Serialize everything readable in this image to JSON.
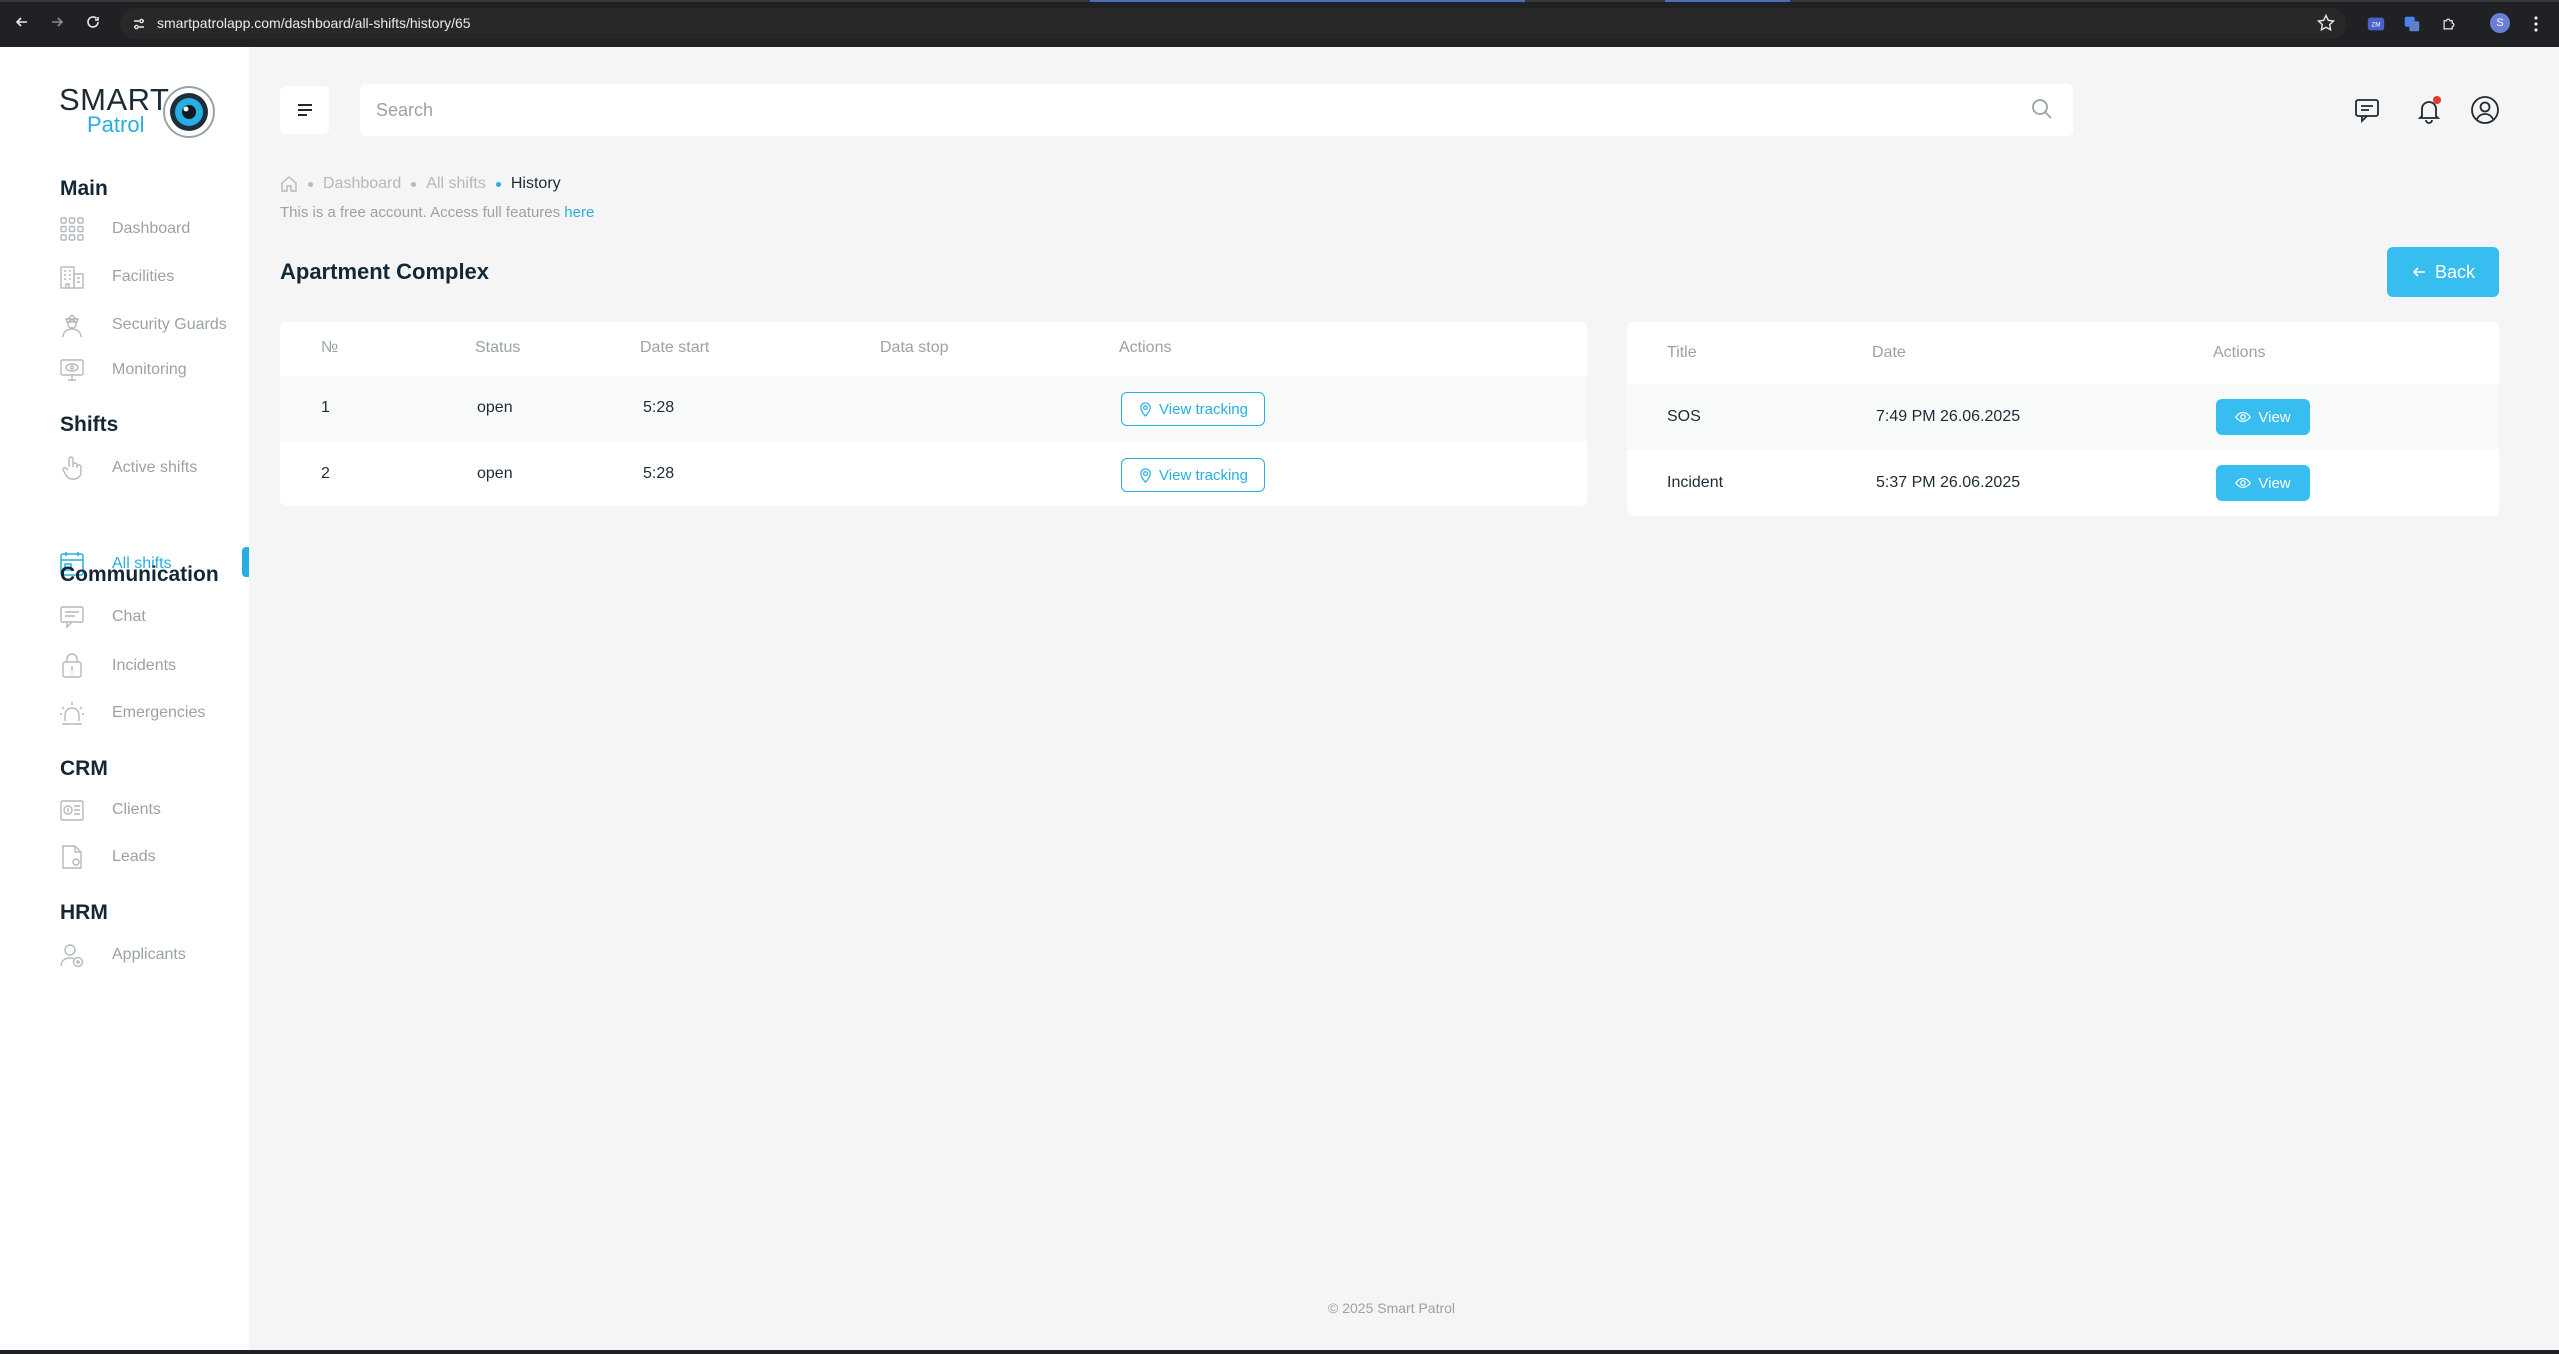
{
  "browser": {
    "url": "smartpatrolapp.com/dashboard/all-shifts/history/65",
    "profile_initial": "S"
  },
  "logo": {
    "line1": "SMART",
    "line2": "Patrol"
  },
  "sidebar": {
    "sections": [
      {
        "title": "Main",
        "items": [
          {
            "label": "Dashboard",
            "icon": "dashboard-grid-icon"
          },
          {
            "label": "Facilities",
            "icon": "building-icon"
          },
          {
            "label": "Security Guards",
            "icon": "guard-icon"
          },
          {
            "label": "Monitoring",
            "icon": "monitor-icon"
          }
        ]
      },
      {
        "title": "Shifts",
        "items": [
          {
            "label": "Active shifts",
            "icon": "pointer-icon"
          },
          {
            "label": "All shifts",
            "icon": "calendar-icon",
            "active": true
          }
        ]
      },
      {
        "title": "Communication",
        "items": [
          {
            "label": "Chat",
            "icon": "chat-icon"
          },
          {
            "label": "Incidents",
            "icon": "incident-icon"
          },
          {
            "label": "Emergencies",
            "icon": "alarm-icon"
          }
        ]
      },
      {
        "title": "CRM",
        "items": [
          {
            "label": "Clients",
            "icon": "clients-icon"
          },
          {
            "label": "Leads",
            "icon": "leads-icon"
          }
        ]
      },
      {
        "title": "HRM",
        "items": [
          {
            "label": "Applicants",
            "icon": "applicant-icon"
          }
        ]
      }
    ]
  },
  "header": {
    "search_placeholder": "Search"
  },
  "breadcrumb": {
    "items": [
      "Dashboard",
      "All shifts"
    ],
    "current": "History"
  },
  "notice": {
    "text": "This is a free account. Access full features ",
    "link": "here"
  },
  "page": {
    "title": "Apartment Complex",
    "back_label": "Back"
  },
  "shifts_table": {
    "columns": [
      "№",
      "Status",
      "Date start",
      "Data stop",
      "Actions"
    ],
    "rows": [
      {
        "num": "1",
        "status": "open",
        "start": "5:28",
        "stop": "",
        "action": "View tracking"
      },
      {
        "num": "2",
        "status": "open",
        "start": "5:28",
        "stop": "",
        "action": "View tracking"
      }
    ]
  },
  "events_table": {
    "columns": [
      "Title",
      "Date",
      "Actions"
    ],
    "rows": [
      {
        "title": "SOS",
        "date": "7:49 PM 26.06.2025",
        "action": "View"
      },
      {
        "title": "Incident",
        "date": "5:37 PM 26.06.2025",
        "action": "View"
      }
    ]
  },
  "footer": "© 2025 Smart Patrol",
  "colors": {
    "accent": "#27aee2",
    "button": "#38bdf0",
    "heading": "#142734",
    "muted": "#9aa2a8"
  }
}
